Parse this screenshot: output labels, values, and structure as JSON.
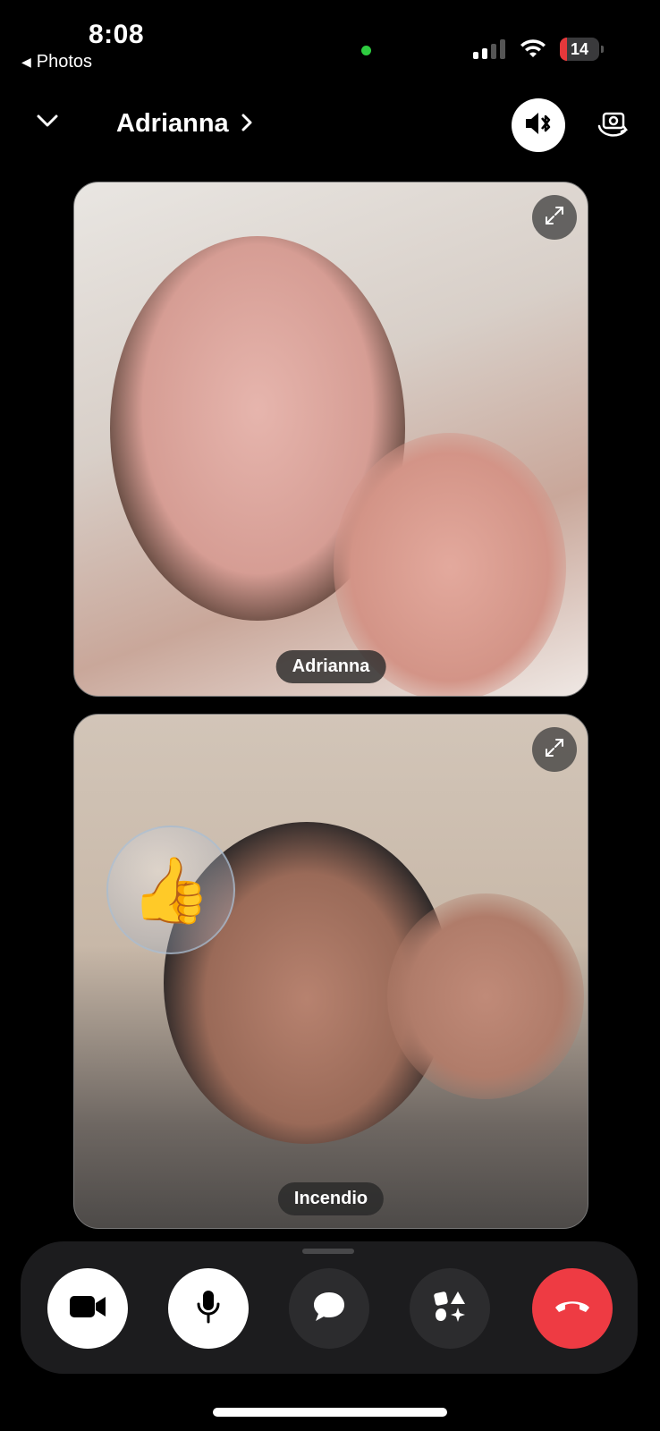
{
  "status_bar": {
    "time": "8:08",
    "back_app_label": "Photos",
    "battery_level": "14",
    "colors": {
      "camera_indicator": "#2ecc40",
      "battery_low": "#e5383b"
    }
  },
  "header": {
    "contact_name": "Adrianna",
    "icons": [
      "chevron-down-icon",
      "chevron-right-icon",
      "bluetooth-speaker-icon",
      "flip-camera-icon"
    ]
  },
  "participants": [
    {
      "name": "Adrianna",
      "expand_icon": "expand-icon"
    },
    {
      "name": "Incendio",
      "expand_icon": "expand-icon",
      "reaction": "thumbs-up"
    }
  ],
  "controls": {
    "buttons": [
      "video-camera-icon",
      "microphone-icon",
      "chat-bubble-icon",
      "effects-shapes-icon",
      "end-call-icon"
    ],
    "colors": {
      "end_call": "#ee3b43",
      "active": "#ffffff",
      "inactive": "#2c2c2e"
    }
  }
}
